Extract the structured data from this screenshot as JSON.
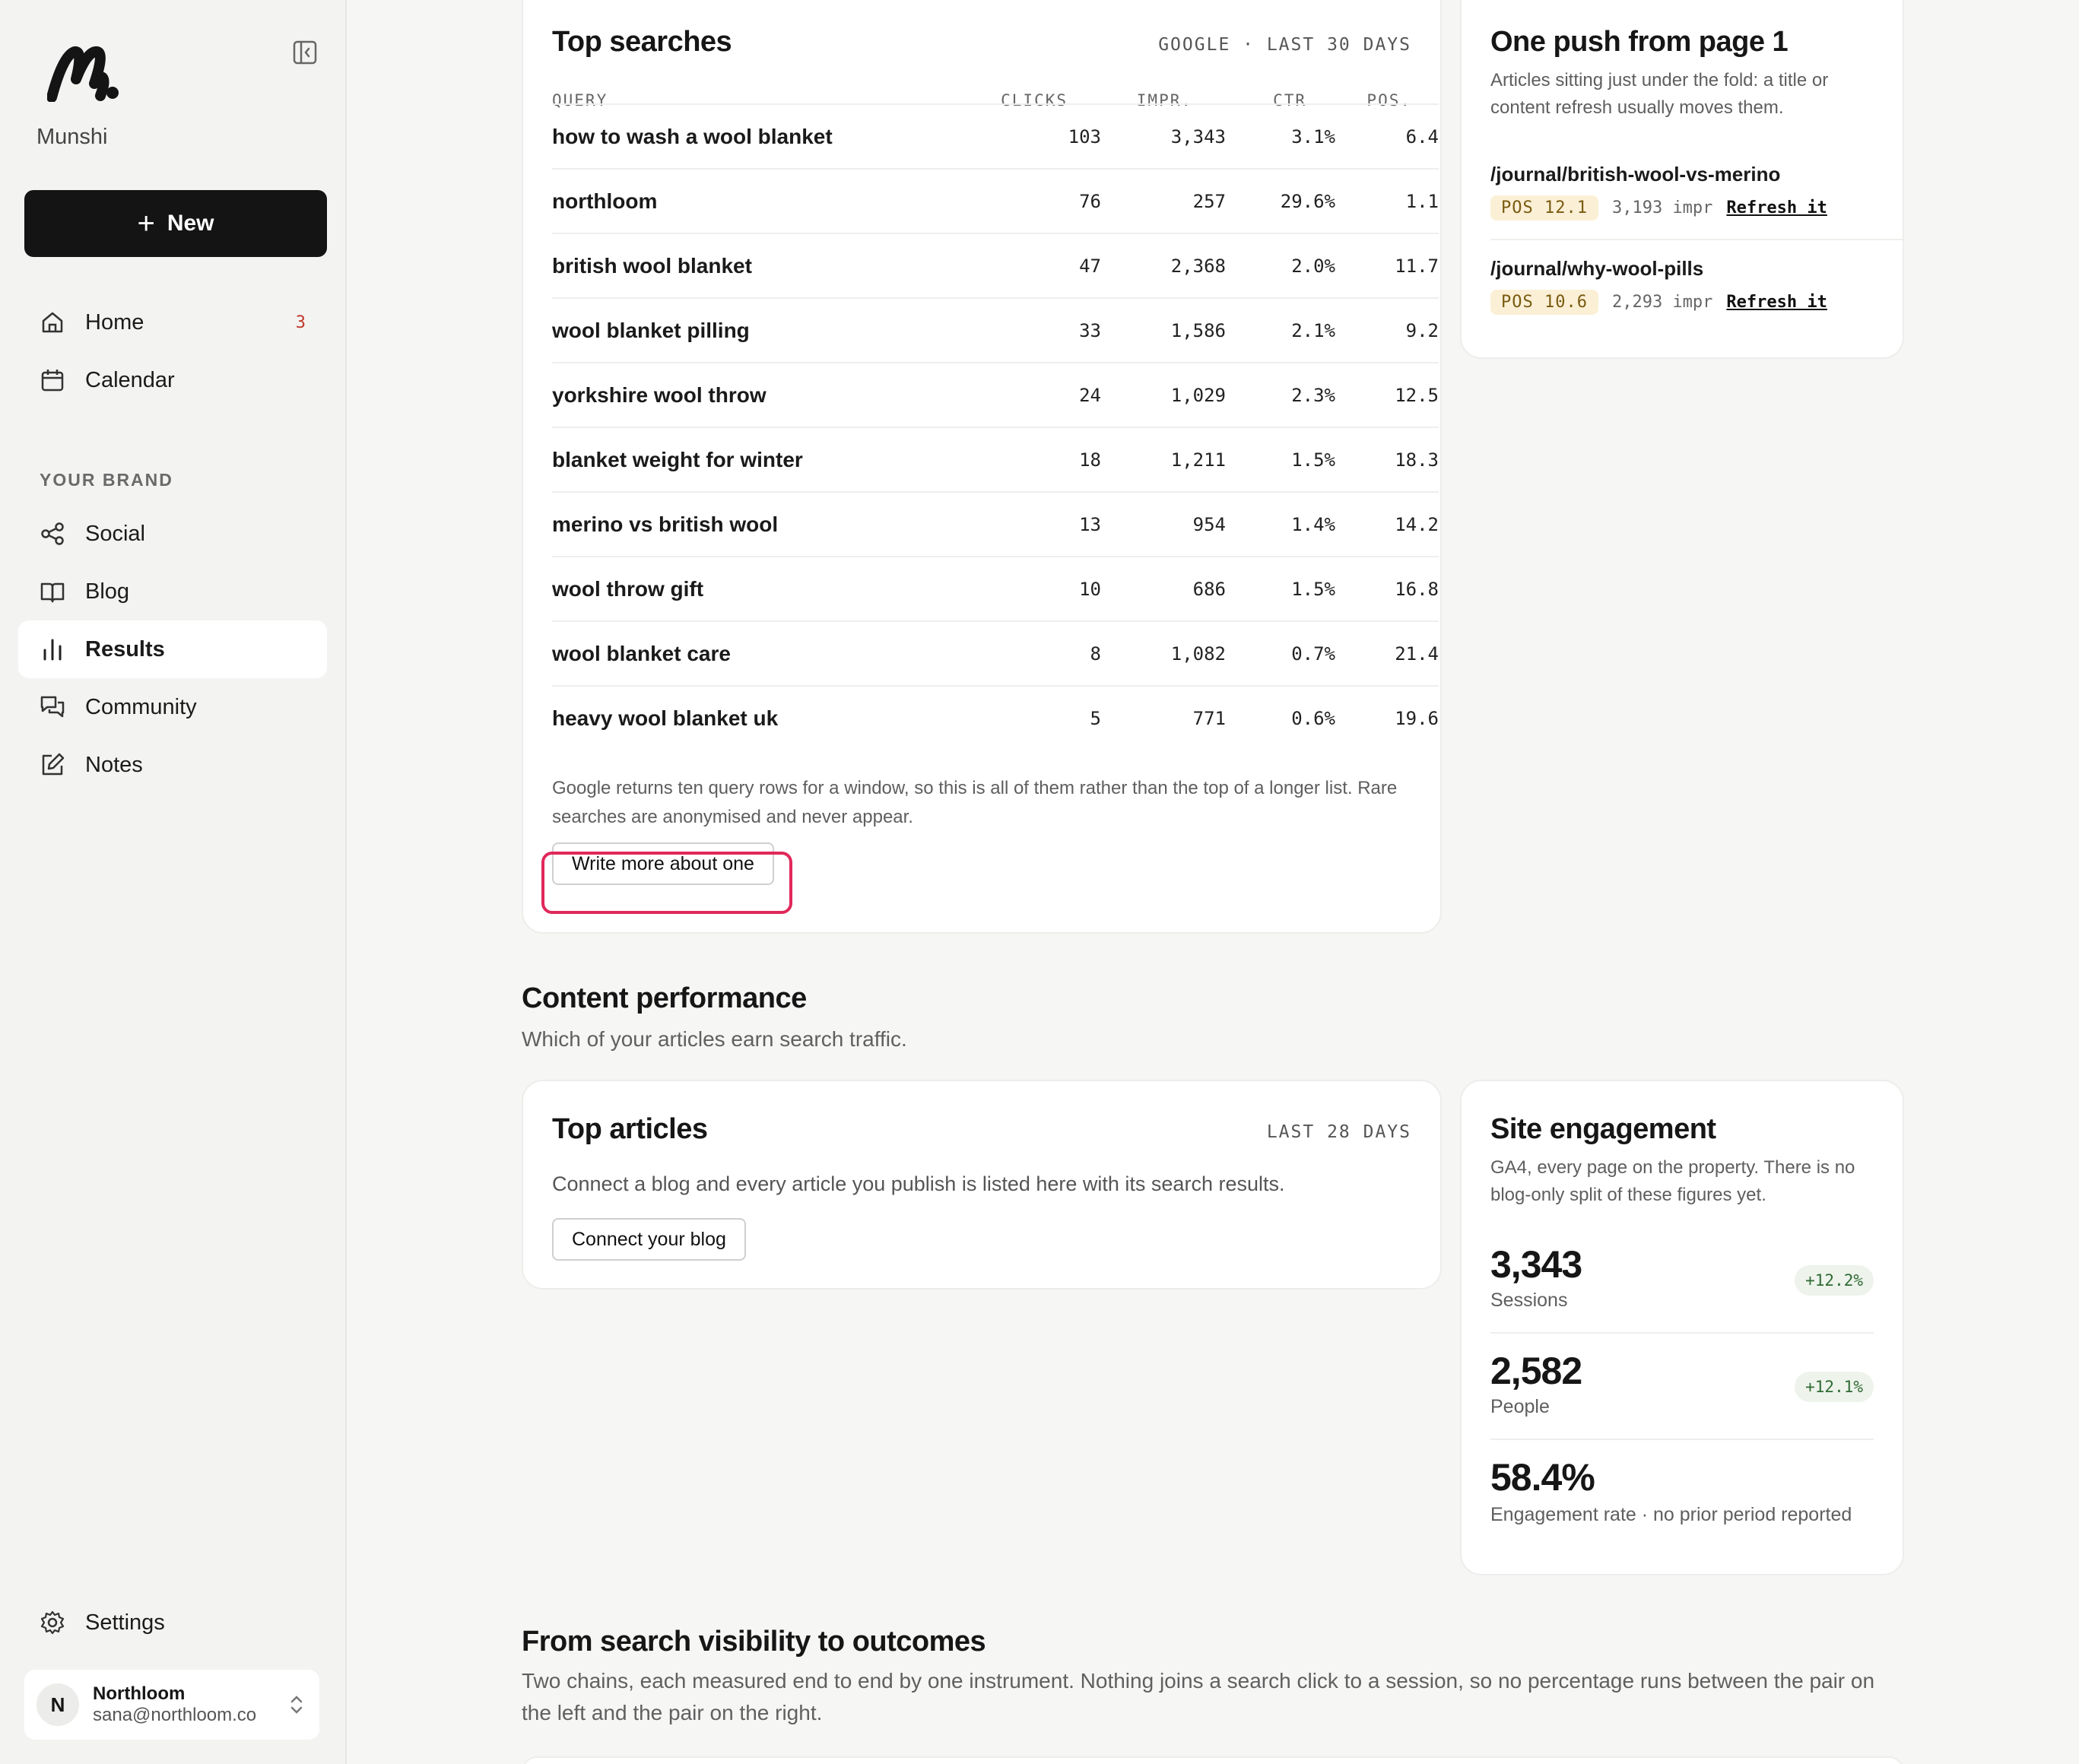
{
  "sidebar": {
    "brand": "Munshi",
    "new_label": "New",
    "nav": [
      {
        "label": "Home",
        "badge": "3"
      },
      {
        "label": "Calendar"
      }
    ],
    "section_label": "YOUR BRAND",
    "brand_nav": [
      {
        "label": "Social"
      },
      {
        "label": "Blog"
      },
      {
        "label": "Results"
      },
      {
        "label": "Community"
      },
      {
        "label": "Notes"
      }
    ],
    "settings_label": "Settings",
    "account": {
      "initial": "N",
      "name": "Northloom",
      "email": "sana@northloom.co"
    }
  },
  "top_searches": {
    "title": "Top searches",
    "meta": "GOOGLE · LAST 30 DAYS",
    "columns": [
      "QUERY",
      "CLICKS",
      "IMPR.",
      "CTR",
      "POS."
    ],
    "rows": [
      {
        "query": "how to wash a wool blanket",
        "clicks": "103",
        "impr": "3,343",
        "ctr": "3.1%",
        "pos": "6.4"
      },
      {
        "query": "northloom",
        "clicks": "76",
        "impr": "257",
        "ctr": "29.6%",
        "pos": "1.1"
      },
      {
        "query": "british wool blanket",
        "clicks": "47",
        "impr": "2,368",
        "ctr": "2.0%",
        "pos": "11.7"
      },
      {
        "query": "wool blanket pilling",
        "clicks": "33",
        "impr": "1,586",
        "ctr": "2.1%",
        "pos": "9.2"
      },
      {
        "query": "yorkshire wool throw",
        "clicks": "24",
        "impr": "1,029",
        "ctr": "2.3%",
        "pos": "12.5"
      },
      {
        "query": "blanket weight for winter",
        "clicks": "18",
        "impr": "1,211",
        "ctr": "1.5%",
        "pos": "18.3"
      },
      {
        "query": "merino vs british wool",
        "clicks": "13",
        "impr": "954",
        "ctr": "1.4%",
        "pos": "14.2"
      },
      {
        "query": "wool throw gift",
        "clicks": "10",
        "impr": "686",
        "ctr": "1.5%",
        "pos": "16.8"
      },
      {
        "query": "wool blanket care",
        "clicks": "8",
        "impr": "1,082",
        "ctr": "0.7%",
        "pos": "21.4"
      },
      {
        "query": "heavy wool blanket uk",
        "clicks": "5",
        "impr": "771",
        "ctr": "0.6%",
        "pos": "19.6"
      }
    ],
    "note": "Google returns ten query rows for a window, so this is all of them rather than the top of a longer list. Rare searches are anonymised and never appear.",
    "action_label": "Write more about one"
  },
  "one_push": {
    "title": "One push from page 1",
    "subtitle": "Articles sitting just under the fold: a title or content refresh usually moves them.",
    "items": [
      {
        "path": "/journal/british-wool-vs-merino",
        "pos": "POS 12.1",
        "impr": "3,193 impr",
        "action": "Refresh it"
      },
      {
        "path": "/journal/why-wool-pills",
        "pos": "POS 10.6",
        "impr": "2,293 impr",
        "action": "Refresh it"
      }
    ]
  },
  "content_performance": {
    "heading": "Content performance",
    "subheading": "Which of your articles earn search traffic."
  },
  "top_articles": {
    "title": "Top articles",
    "meta": "LAST 28 DAYS",
    "body": "Connect a blog and every article you publish is listed here with its search results.",
    "action_label": "Connect your blog"
  },
  "site_engagement": {
    "title": "Site engagement",
    "subtitle": "GA4, every page on the property. There is no blog-only split of these figures yet.",
    "metrics": [
      {
        "value": "3,343",
        "label": "Sessions",
        "delta": "+12.2%"
      },
      {
        "value": "2,582",
        "label": "People",
        "delta": "+12.1%"
      },
      {
        "value": "58.4%",
        "label": "Engagement rate · no prior period reported"
      }
    ]
  },
  "outcomes": {
    "heading": "From search visibility to outcomes",
    "subheading": "Two chains, each measured end to end by one instrument. Nothing joins a search click to a session, so no percentage runs between the pair on the left and the pair on the right."
  },
  "colors": {
    "accent": "#141414",
    "highlight": "#e0285a",
    "badge_bg": "#fbf0d6",
    "delta_green": "#2f6b33"
  }
}
